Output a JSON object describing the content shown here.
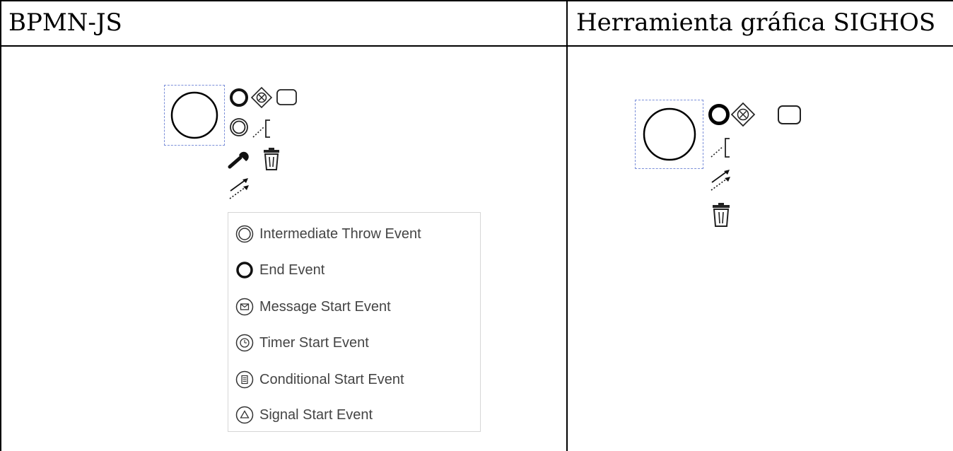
{
  "table": {
    "left_header": "BPMN-JS",
    "right_header": "Herramienta gráfica SIGHOS"
  },
  "left_panel": {
    "context_pad_icons": [
      "end-event-icon",
      "gateway-icon",
      "task-icon",
      "intermediate-event-icon",
      "text-annotation-icon",
      "wrench-icon",
      "trash-icon",
      "connect-icon"
    ],
    "replace_menu": {
      "items": [
        {
          "icon": "intermediate-throw-event-icon",
          "label": "Intermediate Throw Event"
        },
        {
          "icon": "end-event-icon",
          "label": "End Event"
        },
        {
          "icon": "message-start-event-icon",
          "label": "Message Start Event"
        },
        {
          "icon": "timer-start-event-icon",
          "label": "Timer Start Event"
        },
        {
          "icon": "conditional-start-event-icon",
          "label": "Conditional Start Event"
        },
        {
          "icon": "signal-start-event-icon",
          "label": "Signal Start Event"
        }
      ]
    }
  },
  "right_panel": {
    "context_pad_icons": [
      "end-event-icon",
      "gateway-icon",
      "task-icon",
      "text-annotation-icon",
      "connect-icon",
      "trash-icon"
    ]
  }
}
